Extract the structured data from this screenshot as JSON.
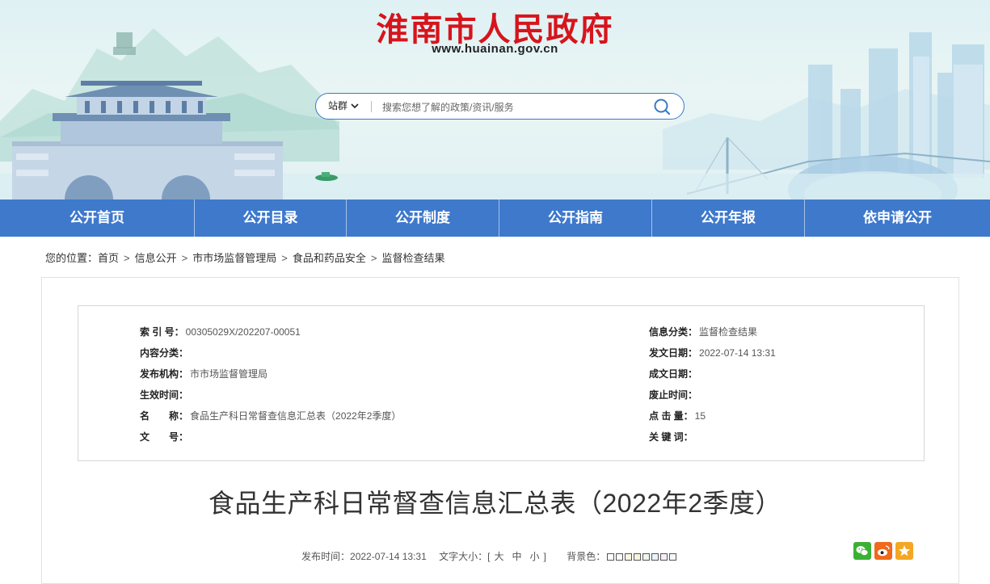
{
  "site": {
    "title": "淮南市人民政府",
    "url": "www.huainan.gov.cn"
  },
  "search": {
    "scope_label": "站群",
    "placeholder": "搜索您想了解的政策/资讯/服务"
  },
  "nav": {
    "items": [
      {
        "label": "公开首页"
      },
      {
        "label": "公开目录"
      },
      {
        "label": "公开制度"
      },
      {
        "label": "公开指南"
      },
      {
        "label": "公开年报"
      },
      {
        "label": "依申请公开"
      }
    ]
  },
  "breadcrumb": {
    "prefix": "您的位置：",
    "items": [
      "首页",
      "信息公开",
      "市市场监督管理局",
      "食品和药品安全",
      "监督检查结果"
    ]
  },
  "meta": {
    "left": [
      {
        "label": "索 引 号：",
        "value": "00305029X/202207-00051"
      },
      {
        "label": "内容分类：",
        "value": ""
      },
      {
        "label": "发布机构：",
        "value": "市市场监督管理局"
      },
      {
        "label": "生效时间：",
        "value": ""
      },
      {
        "label": "名　　称：",
        "value": "食品生产科日常督查信息汇总表（2022年2季度）"
      },
      {
        "label": "文　　号：",
        "value": ""
      }
    ],
    "right": [
      {
        "label": "信息分类：",
        "value": "监督检查结果"
      },
      {
        "label": "发文日期：",
        "value": "2022-07-14 13:31"
      },
      {
        "label": "成文日期：",
        "value": ""
      },
      {
        "label": "废止时间：",
        "value": ""
      },
      {
        "label": "点 击 量：",
        "value": "15"
      },
      {
        "label": "关 键 词：",
        "value": ""
      }
    ]
  },
  "document": {
    "title": "食品生产科日常督查信息汇总表（2022年2季度）",
    "publish_label": "发布时间：",
    "publish_time": "2022-07-14 13:31",
    "font_size_label": "文字大小：",
    "font_size_open": "[",
    "font_size_close": "]",
    "font_sizes": [
      "大",
      "中",
      "小"
    ],
    "background_label": "背景色："
  },
  "background_swatches": [
    "#ffffff",
    "#fafafa",
    "#fdf6e3",
    "#f5f5dc",
    "#eef7ee",
    "#eaf3fb",
    "#f3eef7",
    "#f7f7f7"
  ],
  "share": {
    "icons": [
      "wechat-icon",
      "weibo-icon",
      "favorite-icon"
    ],
    "colors": {
      "wechat": "#3cb034",
      "weibo": "#f06a1c",
      "favorite": "#f5a623"
    }
  },
  "colors": {
    "brand_red": "#d7141c",
    "nav_blue": "#3e79cc",
    "search_border": "#3a79c8"
  }
}
